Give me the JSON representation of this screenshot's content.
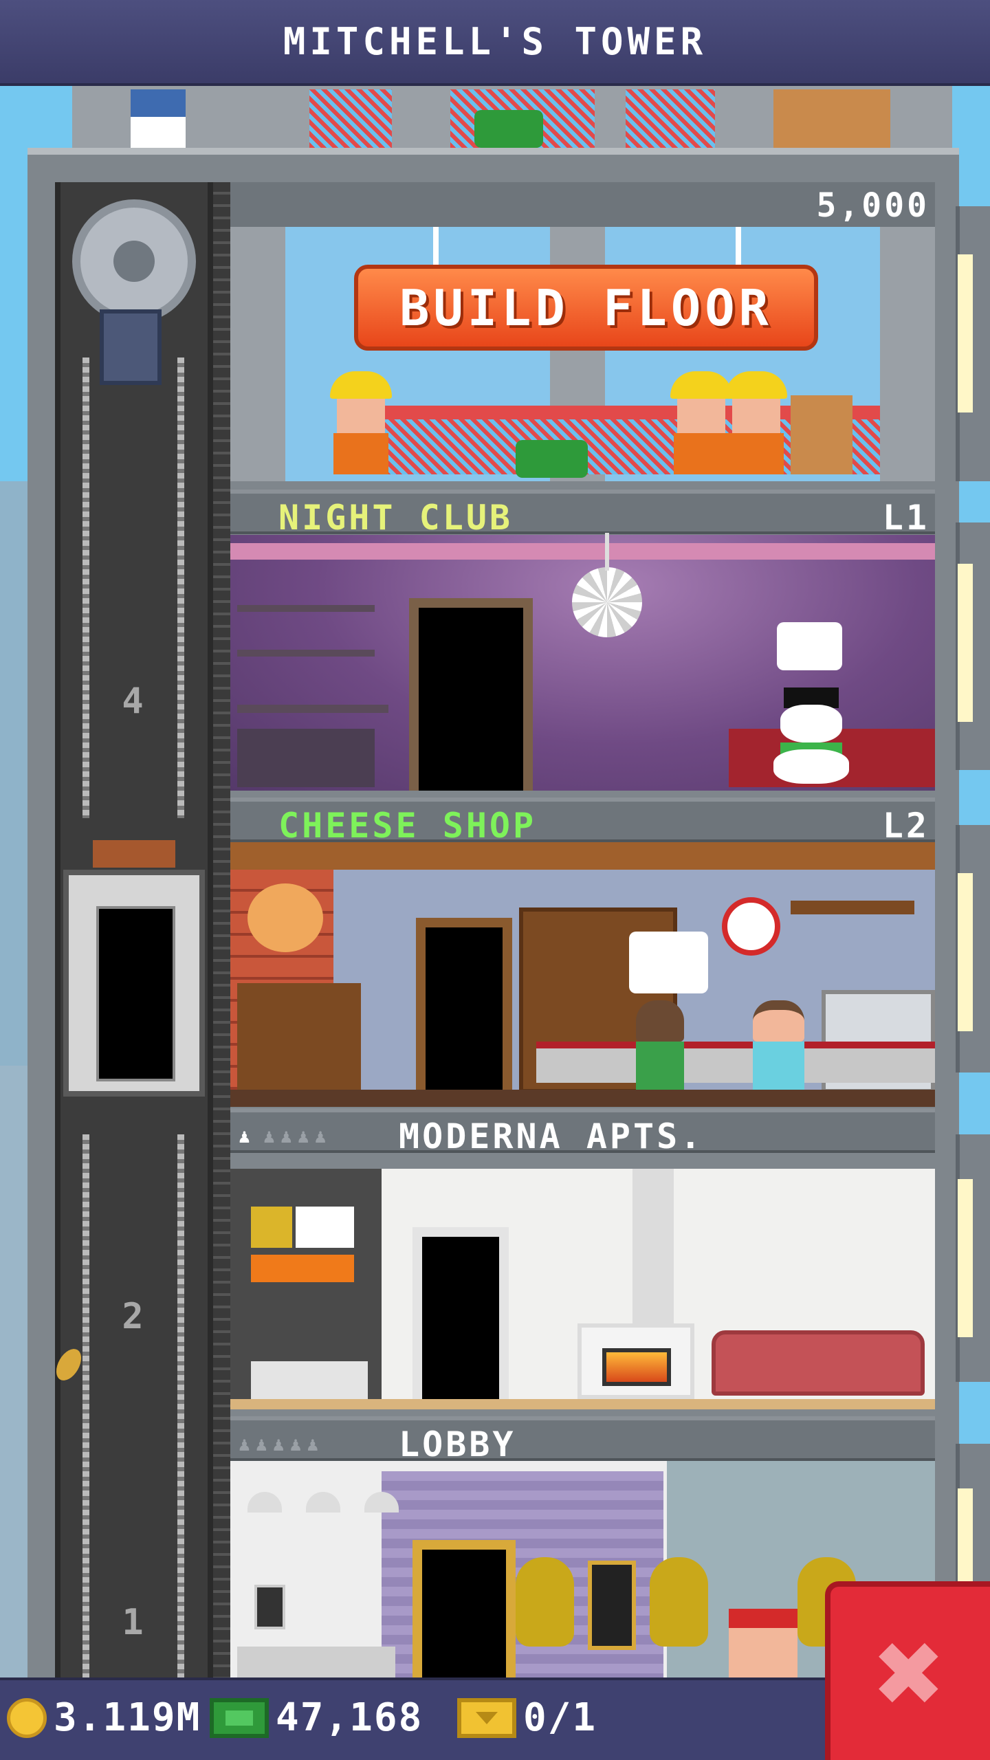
{
  "header": {
    "title": "MITCHELL'S TOWER"
  },
  "build_floor": {
    "cost": "5,000",
    "button_label": "BUILD FLOOR"
  },
  "floors": [
    {
      "name": "NIGHT CLUB",
      "level": "L1",
      "name_color": "#e6f27a"
    },
    {
      "name": "CHEESE SHOP",
      "level": "L2",
      "name_color": "#7ef25a"
    },
    {
      "name": "MODERNA APTS.",
      "level": "",
      "name_color": "#ffffff",
      "residents": "1/5"
    },
    {
      "name": "LOBBY",
      "level": "",
      "name_color": "#ffffff"
    }
  ],
  "elevator": {
    "shaft_numbers": [
      "4",
      "2",
      "1"
    ]
  },
  "status_bar": {
    "coins": "3.119M",
    "bux": "47,168",
    "tickets": "0/1"
  },
  "icons": {
    "coins": "coin-icon",
    "bux": "bux-icon",
    "tickets": "ticket-icon",
    "close": "close-icon"
  }
}
